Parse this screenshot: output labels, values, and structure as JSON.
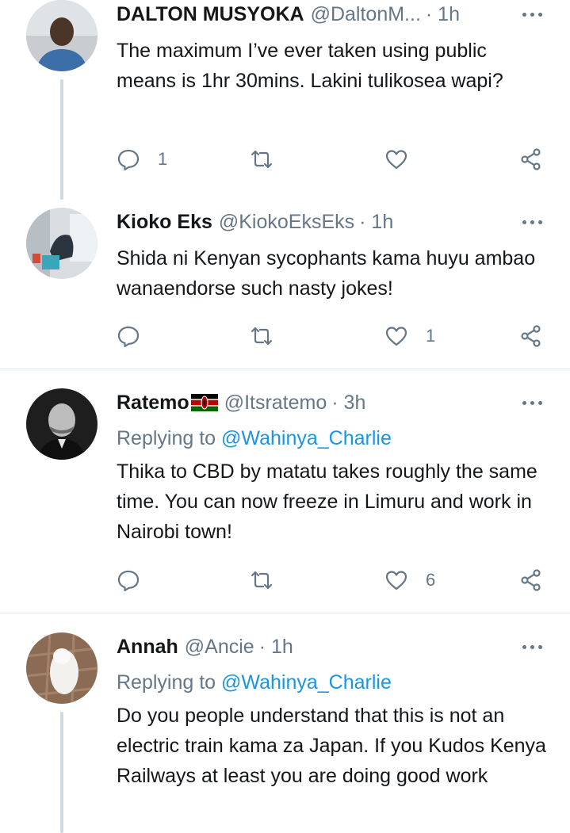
{
  "tweets": [
    {
      "name": "DALTON MUSYOKA",
      "handle": "@DaltonM...",
      "time": "· 1h",
      "text": "The maximum I’ve ever taken using public means is 1hr 30mins. Lakini tulikosea wapi?",
      "reply_count": "1",
      "like_count": ""
    },
    {
      "name": "Kioko Eks",
      "handle": "@KiokoEksEks",
      "time": "· 1h",
      "text": "Shida ni Kenyan sycophants kama huyu ambao wanaendorse such nasty jokes!",
      "reply_count": "",
      "like_count": "1"
    },
    {
      "name": "Ratemo",
      "flag": "kenya-flag",
      "handle": "@Itsratemo",
      "time": "· 3h",
      "replying_prefix": "Replying to ",
      "replying_to": "@Wahinya_Charlie",
      "text": "Thika to CBD by matatu takes roughly the same time. You can now freeze in Limuru and work in Nairobi town!",
      "reply_count": "",
      "like_count": "6"
    },
    {
      "name": "Annah",
      "handle": "@Ancie",
      "time": "· 1h",
      "replying_prefix": "Replying to ",
      "replying_to": "@Wahinya_Charlie",
      "text": "Do you people understand that this is not an electric train kama za Japan. If you Kudos Kenya Railways at least you are doing good work",
      "reply_count": "",
      "like_count": ""
    }
  ],
  "icons": {
    "reply": "reply-icon",
    "retweet": "retweet-icon",
    "like": "heart-icon",
    "share": "share-icon",
    "more": "more-icon"
  },
  "colors": {
    "text": "#14171a",
    "secondary": "#657786",
    "mention": "#1b95e0",
    "divider": "#e1e8ed",
    "thread_line": "#cfd9de"
  }
}
